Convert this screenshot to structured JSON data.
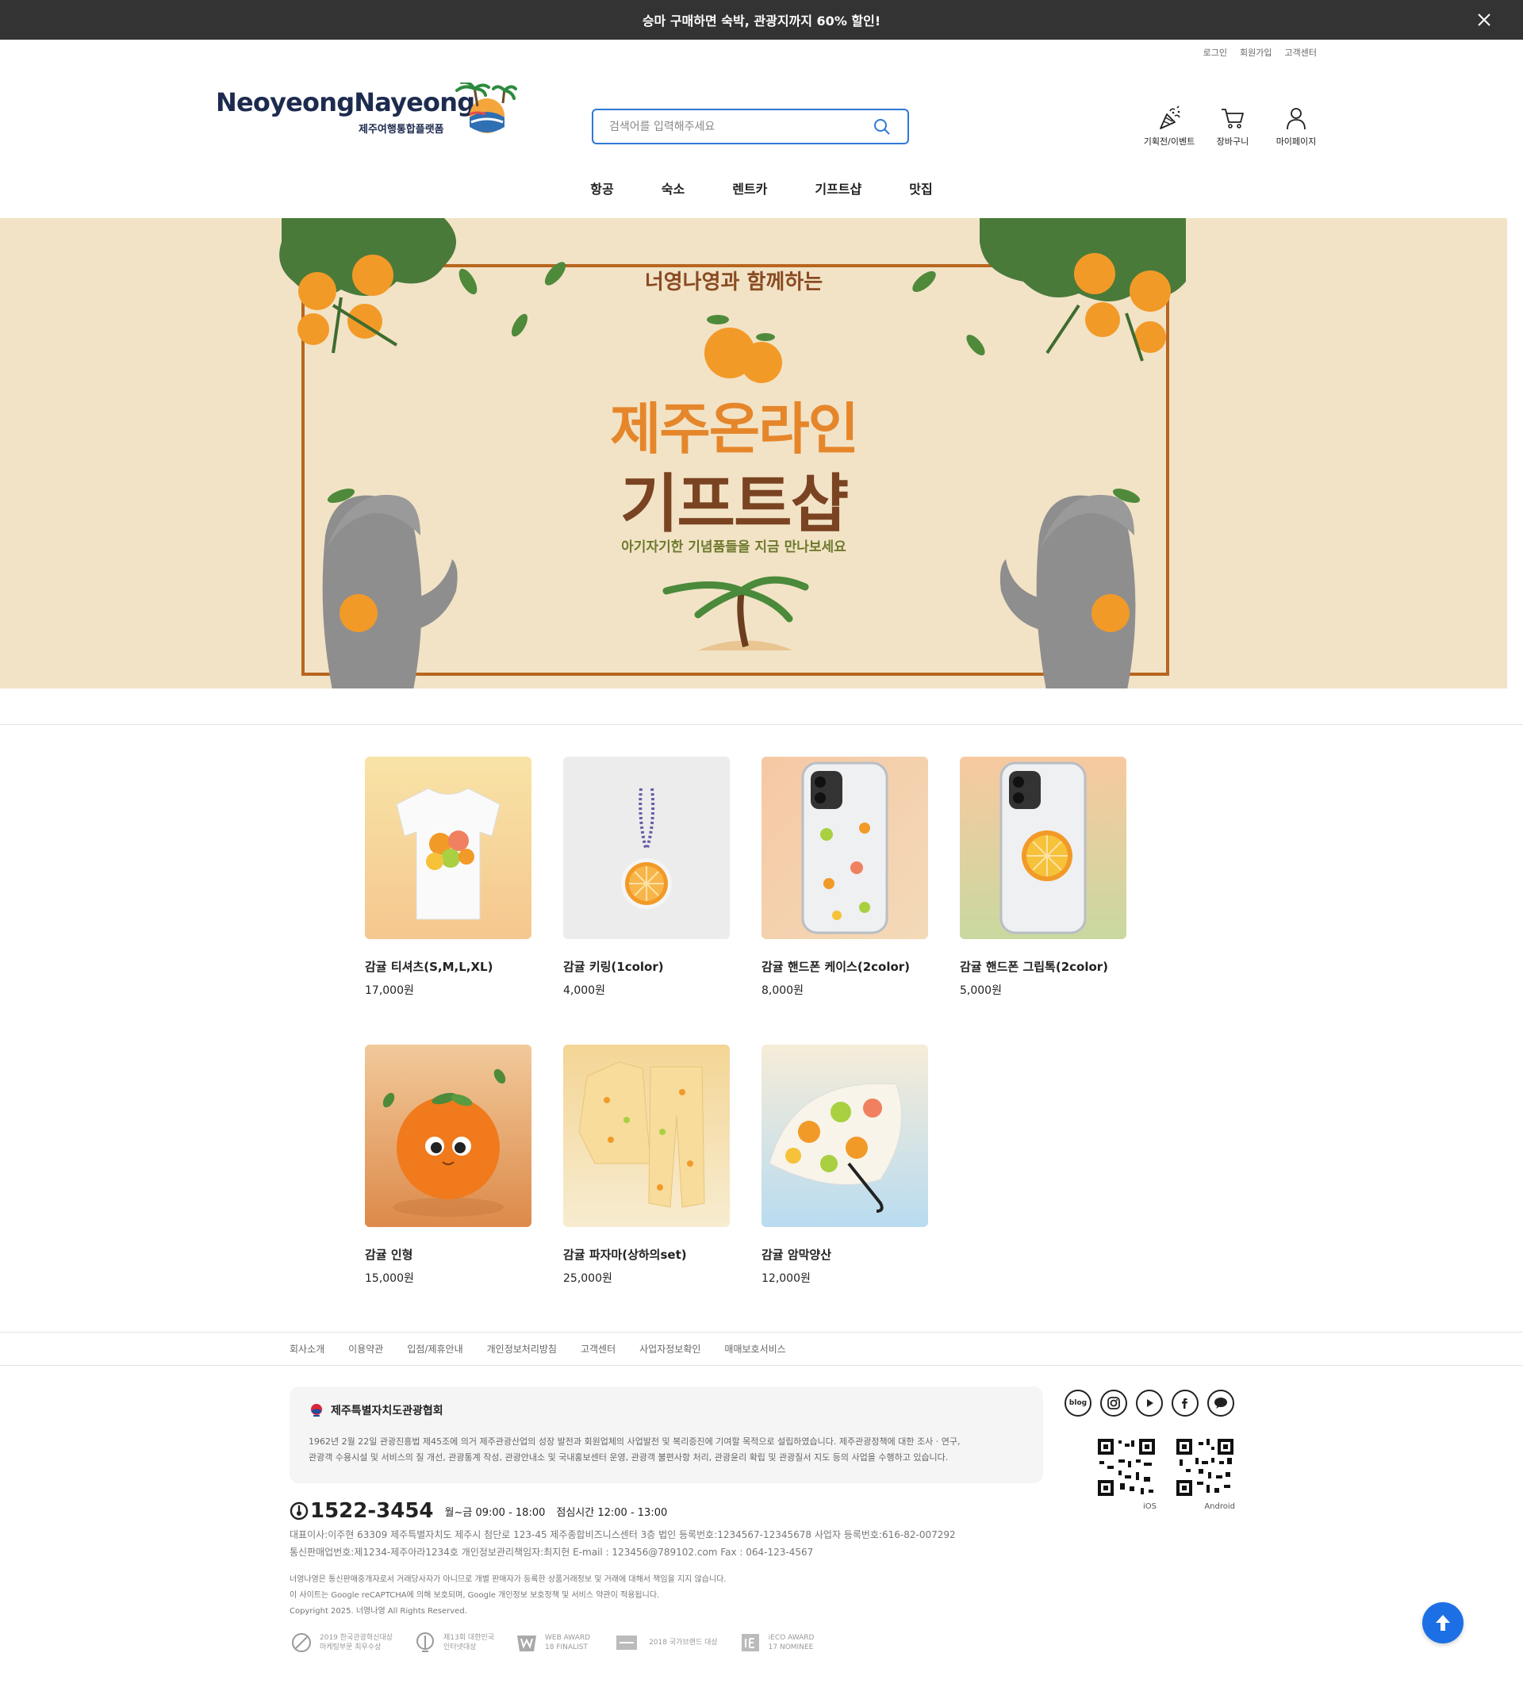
{
  "promo_bar": {
    "text": "승마 구매하면 숙박, 관광지까지 60% 할인!"
  },
  "util_links": [
    "로그인",
    "회원가입",
    "고객센터"
  ],
  "logo": {
    "name": "NeoyeongNayeong",
    "subtitle": "제주여행통합플랫폼"
  },
  "search": {
    "placeholder": "검색어를 입력해주세요"
  },
  "header_icons": [
    {
      "label": "기획전/이벤트",
      "icon": "party-popper-icon"
    },
    {
      "label": "장바구니",
      "icon": "cart-icon"
    },
    {
      "label": "마이페이지",
      "icon": "user-icon"
    }
  ],
  "gnb": [
    "항공",
    "숙소",
    "렌트카",
    "기프트샵",
    "맛집"
  ],
  "hero": {
    "arc_text": "너영나영과 함께하는",
    "title1": "제주온라인",
    "title2": "기프트샵",
    "subtitle": "아기자기한 기념품들을 지금 만나보세요"
  },
  "products": [
    {
      "name": "감귤 티셔츠(S,M,L,XL)",
      "price": "17,000원"
    },
    {
      "name": "감귤 키링(1color)",
      "price": "4,000원"
    },
    {
      "name": "감귤 핸드폰 케이스(2color)",
      "price": "8,000원"
    },
    {
      "name": "감귤 핸드폰 그립톡(2color)",
      "price": "5,000원"
    },
    {
      "name": "감귤 인형",
      "price": "15,000원"
    },
    {
      "name": "감귤 파자마(상하의set)",
      "price": "25,000원"
    },
    {
      "name": "감귤 암막양산",
      "price": "12,000원"
    }
  ],
  "footer_nav": [
    "회사소개",
    "이용약관",
    "입점/제휴안내",
    "개인정보처리방침",
    "고객센터",
    "사업자정보확인",
    "매매보호서비스"
  ],
  "association": {
    "title": "제주특별자치도관광협회",
    "desc_line1": "1962년 2월 22일 관광진흥법 제45조에 의거 제주관광산업의 성장 발전과 회원업체의 사업발전 및 복리증진에 기여할 목적으로 설립하였습니다. 제주관광정책에 대한 조사 · 연구,",
    "desc_line2": "관광객 수용시설 및 서비스의 질 개선, 관광통계 작성, 관광안내소 및 국내홍보센터 운영, 관광객 불편사항 처리, 관광윤리 확립 및 관광질서 지도 등의 사업을 수행하고 있습니다."
  },
  "social": [
    "blog",
    "instagram-icon",
    "youtube-icon",
    "facebook-icon",
    "talk-icon"
  ],
  "qr": [
    {
      "label": "iOS"
    },
    {
      "label": "Android"
    }
  ],
  "contact": {
    "phone": "1522-3454",
    "hours": "월~금 09:00 - 18:00",
    "lunch": "점심시간 12:00 - 13:00"
  },
  "company_info": {
    "line1": "대표이사:이주현    63309 제주특별자치도 제주시 첨단로 123-45 제주종합비즈니스센터 3층    법인 등록번호:1234567-12345678    사업자 등록번호:616-82-007292",
    "line2": "통신판매업번호:제1234-제주아라1234호    개인정보관리책임자:최지헌    E-mail : 123456@789102.com    Fax : 064-123-4567"
  },
  "notes": {
    "line1": "너영나영은 통신판매중개자로서 거래당사자가 아니므로 개별 판매자가 등록한 상품거래정보 및 거래에 대해서 책임을 지지 않습니다.",
    "line2": "이 사이트는 Google reCAPTCHA에 의해 보호되며, Google 개인정보 보호정책 및 서비스 약관이 적용됩니다.",
    "line3": "Copyright 2025. 너영나영 All Rights Reserved."
  },
  "awards": [
    {
      "line1": "2019 한국관광혁신대상",
      "line2": "마케팅부문 최우수상"
    },
    {
      "line1": "제13회 대한민국",
      "line2": "인터넷대상"
    },
    {
      "line1": "WEB AWARD",
      "line2": "18 FINALIST"
    },
    {
      "line1": "2018 국가브랜드 대상",
      "line2": ""
    },
    {
      "line1": "iECO AWARD",
      "line2": "17 NOMINEE"
    }
  ],
  "colors": {
    "accent": "#2f78d8",
    "topbar": "#333333",
    "hero_bg": "#f2e3c6",
    "orange": "#e5862b",
    "brown": "#7a4322"
  }
}
